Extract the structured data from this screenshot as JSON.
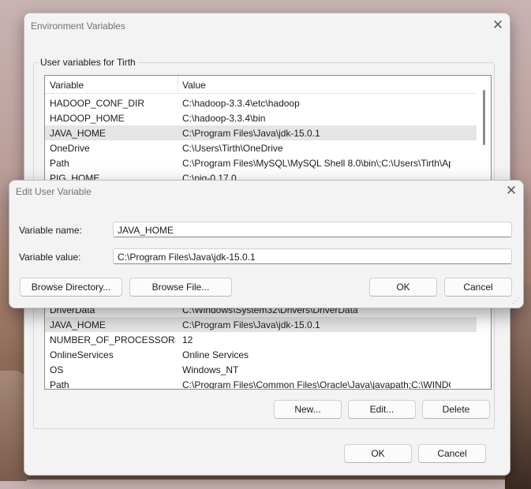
{
  "main_window": {
    "title": "Environment Variables",
    "user_group_label": "User variables for Tirth",
    "columns": [
      "Variable",
      "Value"
    ],
    "user_rows": [
      {
        "name": "HADOOP_CONF_DIR",
        "value": "C:\\hadoop-3.3.4\\etc\\hadoop",
        "selected": false
      },
      {
        "name": "HADOOP_HOME",
        "value": "C:\\hadoop-3.3.4\\bin",
        "selected": false
      },
      {
        "name": "JAVA_HOME",
        "value": "C:\\Program Files\\Java\\jdk-15.0.1",
        "selected": true
      },
      {
        "name": "OneDrive",
        "value": "C:\\Users\\Tirth\\OneDrive",
        "selected": false
      },
      {
        "name": "Path",
        "value": "C:\\Program Files\\MySQL\\MySQL Shell 8.0\\bin\\;C:\\Users\\Tirth\\App...",
        "selected": false
      },
      {
        "name": "PIG_HOME",
        "value": "C:\\pig-0.17.0",
        "selected": false
      }
    ],
    "system_rows": [
      {
        "name": "DriverData",
        "value": "C:\\Windows\\System32\\Drivers\\DriverData",
        "selected": false
      },
      {
        "name": "JAVA_HOME",
        "value": "C:\\Program Files\\Java\\jdk-15.0.1",
        "selected": true
      },
      {
        "name": "NUMBER_OF_PROCESSORS",
        "value": "12",
        "selected": false
      },
      {
        "name": "OnlineServices",
        "value": "Online Services",
        "selected": false
      },
      {
        "name": "OS",
        "value": "Windows_NT",
        "selected": false
      },
      {
        "name": "Path",
        "value": "C:\\Program Files\\Common Files\\Oracle\\Java\\javapath;C:\\WINDOW...",
        "selected": false
      }
    ],
    "system_buttons": {
      "new": "New...",
      "edit": "Edit...",
      "delete": "Delete"
    },
    "ok": "OK",
    "cancel": "Cancel"
  },
  "edit_dialog": {
    "title": "Edit User Variable",
    "name_label": "Variable name:",
    "name_value": "JAVA_HOME",
    "value_label": "Variable value:",
    "value_value": "C:\\Program Files\\Java\\jdk-15.0.1",
    "browse_directory": "Browse Directory...",
    "browse_file": "Browse File...",
    "ok": "OK",
    "cancel": "Cancel"
  }
}
